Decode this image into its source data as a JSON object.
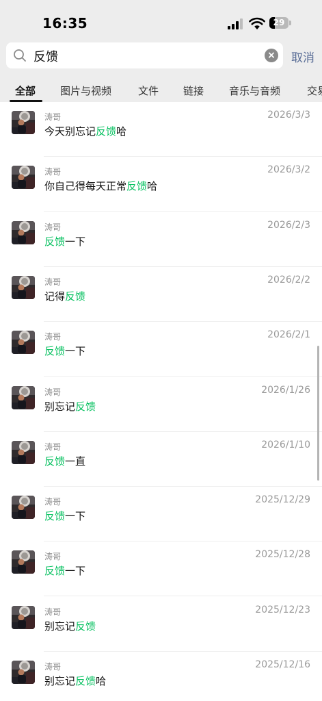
{
  "status": {
    "time": "16:35",
    "battery": "29"
  },
  "search": {
    "query": "反馈",
    "cancel_label": "取消"
  },
  "tabs": [
    "全部",
    "图片与视频",
    "文件",
    "链接",
    "音乐与音频",
    "交易"
  ],
  "results": [
    {
      "sender": "涛哥",
      "date": "2026/3/3",
      "before": "今天别忘记",
      "match": "反馈",
      "after": "哈"
    },
    {
      "sender": "涛哥",
      "date": "2026/3/2",
      "before": "你自己得每天正常",
      "match": "反馈",
      "after": "哈"
    },
    {
      "sender": "涛哥",
      "date": "2026/2/3",
      "before": "",
      "match": "反馈",
      "after": "一下"
    },
    {
      "sender": "涛哥",
      "date": "2026/2/2",
      "before": "记得",
      "match": "反馈",
      "after": ""
    },
    {
      "sender": "涛哥",
      "date": "2026/2/1",
      "before": "",
      "match": "反馈",
      "after": "一下"
    },
    {
      "sender": "涛哥",
      "date": "2026/1/26",
      "before": "别忘记",
      "match": "反馈",
      "after": ""
    },
    {
      "sender": "涛哥",
      "date": "2026/1/10",
      "before": "",
      "match": "反馈",
      "after": "一直"
    },
    {
      "sender": "涛哥",
      "date": "2025/12/29",
      "before": "",
      "match": "反馈",
      "after": "一下"
    },
    {
      "sender": "涛哥",
      "date": "2025/12/28",
      "before": "",
      "match": "反馈",
      "after": "一下"
    },
    {
      "sender": "涛哥",
      "date": "2025/12/23",
      "before": "别忘记",
      "match": "反馈",
      "after": ""
    },
    {
      "sender": "涛哥",
      "date": "2025/12/16",
      "before": "别忘记",
      "match": "反馈",
      "after": "哈"
    }
  ],
  "colors": {
    "highlight": "#07c160",
    "link": "#576b95",
    "header_bg": "#ededed"
  }
}
